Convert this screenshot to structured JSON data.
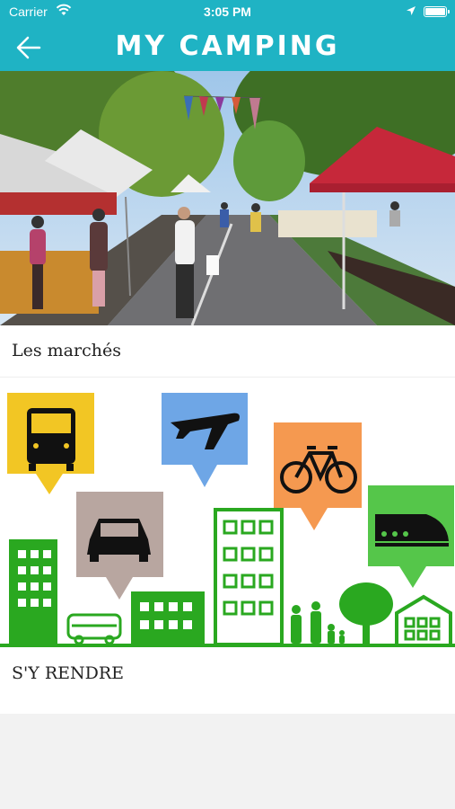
{
  "status_bar": {
    "carrier": "Carrier",
    "time": "3:05 PM",
    "icons": [
      "wifi-icon",
      "location-arrow-icon",
      "battery-icon"
    ]
  },
  "nav": {
    "title": "MY CAMPING",
    "back_icon": "back-arrow-icon",
    "background_color": "#1fb3c4"
  },
  "sections": [
    {
      "label": "Les marchés",
      "image": "outdoor market street photo with tents"
    },
    {
      "label": "S'Y RENDRE",
      "image": "transport illustration: bus, plane, bike, car, train over green city"
    }
  ]
}
